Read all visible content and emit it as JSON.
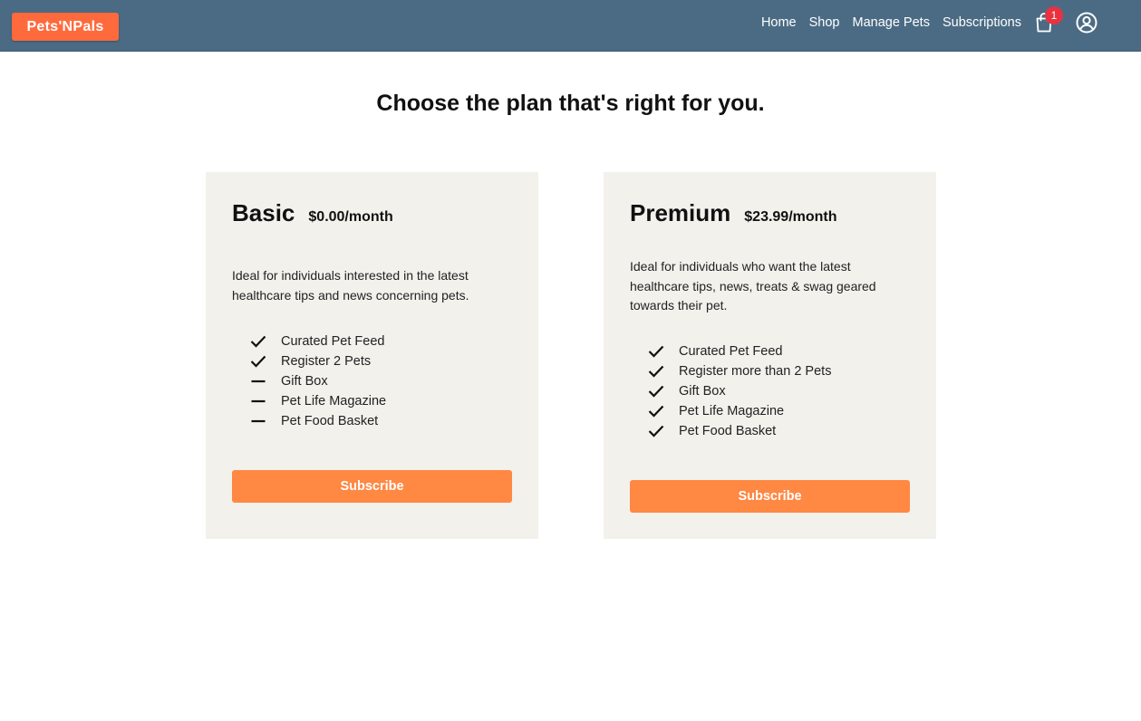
{
  "brand": {
    "name": "Pets'NPals",
    "color": "#ff6a3d"
  },
  "nav": {
    "links": [
      "Home",
      "Shop",
      "Manage Pets",
      "Subscriptions"
    ],
    "cart_count": "1",
    "cart_icon": "shopping-bag-icon",
    "account_icon": "user-circle-icon",
    "bar_color": "#4b6b84"
  },
  "page": {
    "title": "Choose the plan that's right for you."
  },
  "plans": [
    {
      "name": "Basic",
      "price": "$0.00/month",
      "description": "Ideal for individuals interested in the latest healthcare tips and news concerning pets.",
      "features": [
        {
          "label": "Curated Pet Feed",
          "included": true
        },
        {
          "label": "Register 2 Pets",
          "included": true
        },
        {
          "label": "Gift Box",
          "included": false
        },
        {
          "label": "Pet Life Magazine",
          "included": false
        },
        {
          "label": "Pet Food Basket",
          "included": false
        }
      ],
      "button": "Subscribe"
    },
    {
      "name": "Premium",
      "price": "$23.99/month",
      "description": "Ideal for individuals who want the latest healthcare tips, news, treats & swag geared towards their pet.",
      "features": [
        {
          "label": "Curated Pet Feed",
          "included": true
        },
        {
          "label": "Register more than 2 Pets",
          "included": true
        },
        {
          "label": "Gift Box",
          "included": true
        },
        {
          "label": "Pet Life Magazine",
          "included": true
        },
        {
          "label": "Pet Food Basket",
          "included": true
        }
      ],
      "button": "Subscribe"
    }
  ],
  "colors": {
    "card_bg": "#f2f1ec",
    "button": "#ff8843",
    "badge": "#e8323f"
  }
}
